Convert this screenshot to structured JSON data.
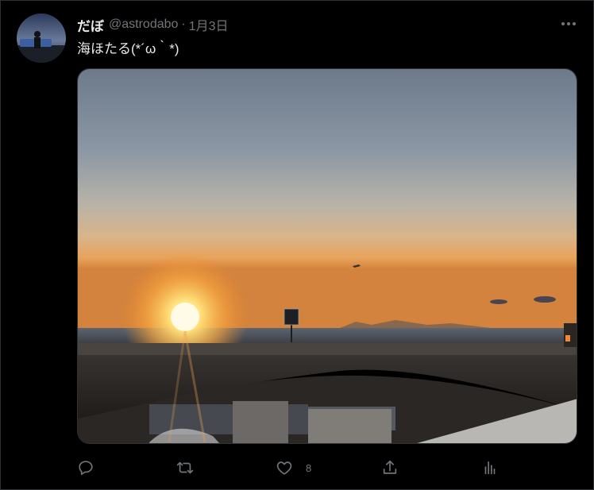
{
  "tweet": {
    "display_name": "だぼ",
    "handle": "@astrodabo",
    "separator": "·",
    "date": "1月3日",
    "text": "海ほたる(*´ω｀*)",
    "avatar_icon": "user-avatar",
    "more_icon": "more-dots-icon",
    "media": {
      "description_icon": "sunset-photo"
    }
  },
  "actions": {
    "reply": {
      "icon": "reply-icon"
    },
    "retweet": {
      "icon": "retweet-icon"
    },
    "like": {
      "icon": "heart-icon",
      "count": "8"
    },
    "share": {
      "icon": "share-icon"
    },
    "analytics": {
      "icon": "analytics-icon"
    }
  },
  "colors": {
    "background": "#000000",
    "text_primary": "#e7e9ea",
    "text_secondary": "#71767b",
    "border": "#2f3336"
  }
}
